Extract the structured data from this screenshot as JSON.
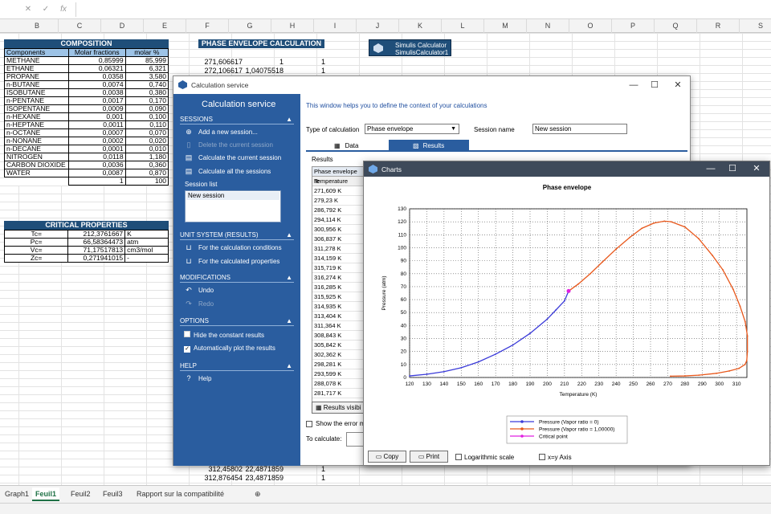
{
  "formula_bar": {
    "cancel": "✕",
    "enter": "✓",
    "fx": "fx"
  },
  "columns": [
    "B",
    "C",
    "D",
    "E",
    "F",
    "G",
    "H",
    "I",
    "J",
    "K",
    "L",
    "M",
    "N",
    "O",
    "P",
    "Q",
    "R",
    "S"
  ],
  "composition": {
    "title": "COMPOSITION",
    "headers": [
      "Components",
      "Molar fractions",
      "molar %"
    ],
    "rows": [
      [
        "METHANE",
        "0,85999",
        "85,999"
      ],
      [
        "ETHANE",
        "0,06321",
        "6,321"
      ],
      [
        "PROPANE",
        "0,0358",
        "3,580"
      ],
      [
        "n-BUTANE",
        "0,0074",
        "0,740"
      ],
      [
        "ISOBUTANE",
        "0,0038",
        "0,380"
      ],
      [
        "n-PENTANE",
        "0,0017",
        "0,170"
      ],
      [
        "ISOPENTANE",
        "0,0009",
        "0,090"
      ],
      [
        "n-HEXANE",
        "0,001",
        "0,100"
      ],
      [
        "n-HEPTANE",
        "0,0011",
        "0,110"
      ],
      [
        "n-OCTANE",
        "0,0007",
        "0,070"
      ],
      [
        "n-NONANE",
        "0,0002",
        "0,020"
      ],
      [
        "n-DECANE",
        "0,0001",
        "0,010"
      ],
      [
        "NITROGEN",
        "0,0118",
        "1,180"
      ],
      [
        "CARBON DIOXIDE",
        "0,0036",
        "0,360"
      ],
      [
        "WATER",
        "0,0087",
        "0,870"
      ],
      [
        "",
        "1",
        "100"
      ]
    ]
  },
  "critical": {
    "title": "CRITICAL PROPERTIES",
    "rows": [
      [
        "Tc=",
        "212,3761667",
        "K"
      ],
      [
        "Pc=",
        "66,58364473",
        "atm"
      ],
      [
        "Vc=",
        "71,17517813",
        "cm3/mol"
      ],
      [
        "Zc=",
        "0,271941015",
        "-"
      ]
    ]
  },
  "phase_env": {
    "title": "PHASE ENVELOPE CALCULATION",
    "top_rows": [
      [
        "271,606617",
        "1",
        "1"
      ],
      [
        "272,106617",
        "1,04075518",
        "1"
      ]
    ],
    "bottom_rows": [
      [
        "312,45802",
        "22,4871859",
        "1"
      ],
      [
        "312,876454",
        "23,4871859",
        "1"
      ]
    ]
  },
  "simulis_button": {
    "line1": "Simulis Calculator",
    "line2": "SimulisCalculator1"
  },
  "sheet_tabs": [
    "Graph1",
    "Feuil1",
    "Feuil2",
    "Feuil3",
    "Rapport sur la compatibilité"
  ],
  "active_tab": "Feuil1",
  "calc_window": {
    "title": "Calculation service",
    "sidebar_title": "Calculation service",
    "sessions_header": "SESSIONS",
    "sessions_items": [
      "Add a new session...",
      "Delete the current session",
      "Calculate the current session",
      "Calculate all the sessions"
    ],
    "session_list_label": "Session list",
    "session_list": [
      "New session"
    ],
    "unit_header": "UNIT SYSTEM (RESULTS)",
    "unit_items": [
      "For the calculation conditions",
      "For the calculated properties"
    ],
    "mod_header": "MODIFICATIONS",
    "mod_items": [
      "Undo",
      "Redo"
    ],
    "opt_header": "OPTIONS",
    "opt_items": [
      "Hide the constant results",
      "Automatically plot the results"
    ],
    "help_header": "HELP",
    "help_item": "Help",
    "intro": "This window helps you to define the context of your calculations",
    "type_label": "Type of calculation",
    "type_value": "Phase envelope",
    "session_name_label": "Session name",
    "session_name_value": "New session",
    "tab_data": "Data",
    "tab_results": "Results",
    "results_label": "Results",
    "results_col1": "Phase envelope re",
    "results_col2": "Temperature",
    "temperatures": [
      "271,609 K",
      "279,23 K",
      "286,792 K",
      "294,114 K",
      "300,956 K",
      "306,837 K",
      "311,278 K",
      "314,159 K",
      "315,719 K",
      "316,274 K",
      "316,285 K",
      "315,925 K",
      "314,935 K",
      "313,404 K",
      "311,364 K",
      "308,843 K",
      "305,842 K",
      "302,362 K",
      "298,281 K",
      "293,599 K",
      "288,078 K",
      "281,717 K"
    ],
    "results_visible_btn": "Results visibi",
    "show_error": "Show the error m",
    "to_calculate": "To calculate:"
  },
  "charts_window": {
    "title": "Charts",
    "copy": "Copy",
    "print": "Print",
    "log_scale": "Logarithmic scale",
    "xy_axis": "x=y Axis"
  },
  "chart_data": {
    "type": "line",
    "title": "Phase envelope",
    "xlabel": "Temperature (K)",
    "ylabel": "Pressure (atm)",
    "xlim": [
      120,
      316
    ],
    "ylim": [
      0,
      130
    ],
    "xticks": [
      120,
      130,
      140,
      150,
      160,
      170,
      180,
      190,
      200,
      210,
      220,
      230,
      240,
      250,
      260,
      270,
      280,
      290,
      300,
      310
    ],
    "yticks": [
      0,
      10,
      20,
      30,
      40,
      50,
      60,
      70,
      80,
      90,
      100,
      110,
      120,
      130
    ],
    "grid": true,
    "legend_placement": "bottom-center",
    "series": [
      {
        "name": "Pressure (Vapor ratio = 0)",
        "color": "#3b3bd9",
        "x": [
          120,
          130,
          140,
          150,
          160,
          170,
          180,
          190,
          200,
          205,
          210,
          212.4
        ],
        "y": [
          1.2,
          2.5,
          4.5,
          7.5,
          12,
          18,
          25,
          34,
          45,
          52,
          59,
          66.6
        ]
      },
      {
        "name": "Pressure (Vapor ratio = 1,00000)",
        "color": "#e8581c",
        "x": [
          212.4,
          218,
          225,
          232,
          240,
          248,
          255,
          262,
          268,
          272,
          280,
          288,
          296,
          302,
          308,
          312,
          315,
          316.3,
          316.3,
          315.9,
          314.9,
          311.4,
          305.8,
          298.3,
          288.1,
          280,
          271.6
        ],
        "y": [
          66.6,
          72,
          80,
          89,
          99,
          108,
          115,
          119,
          120.5,
          120,
          116,
          107,
          94,
          83,
          68,
          55,
          43,
          32,
          20,
          13,
          10,
          7,
          5,
          3.2,
          1.8,
          1.2,
          1.0
        ]
      },
      {
        "name": "Critical point",
        "color": "#e020e0",
        "x": [
          212.4
        ],
        "y": [
          66.6
        ]
      }
    ]
  }
}
